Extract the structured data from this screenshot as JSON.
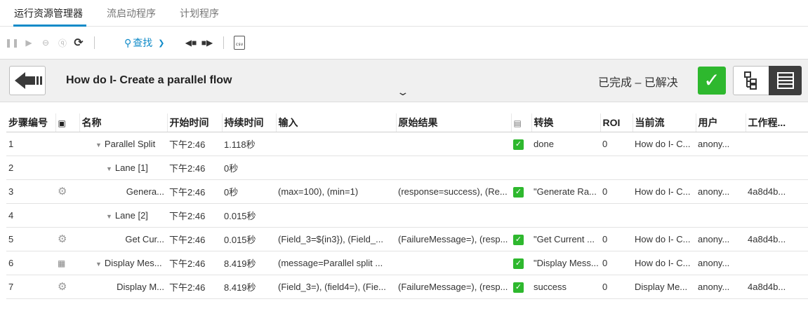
{
  "tabs": {
    "run_explorer": "运行资源管理器",
    "flow_launcher": "流启动程序",
    "scheduler": "计划程序"
  },
  "toolbar": {
    "find_label": "查找",
    "csv_label": "csv"
  },
  "header": {
    "flow_title": "How do I- Create a parallel flow",
    "status": "已完成 – 已解决"
  },
  "table": {
    "columns": {
      "step": "步骤编号",
      "name": "名称",
      "start": "开始时间",
      "duration": "持续时间",
      "input": "输入",
      "raw_result": "原始结果",
      "transition": "转换",
      "roi": "ROI",
      "current_flow": "当前流",
      "user": "用户",
      "worker": "工作程..."
    },
    "rows": [
      {
        "step": "1",
        "name": "Parallel Split",
        "start": "下午2:46",
        "duration": "1.118秒",
        "input": "",
        "raw_result": "",
        "transition": "done",
        "roi": "0",
        "current_flow": "How do I- C...",
        "user": "anony...",
        "worker": ""
      },
      {
        "step": "2",
        "name": "Lane [1]",
        "start": "下午2:46",
        "duration": "0秒",
        "input": "",
        "raw_result": "",
        "transition": "",
        "roi": "",
        "current_flow": "",
        "user": "",
        "worker": ""
      },
      {
        "step": "3",
        "name": "Genera...",
        "start": "下午2:46",
        "duration": "0秒",
        "input": "(max=100), (min=1)",
        "raw_result": "(response=success), (Re...",
        "transition": "\"Generate Ra...",
        "roi": "0",
        "current_flow": "How do I- C...",
        "user": "anony...",
        "worker": "4a8d4b..."
      },
      {
        "step": "4",
        "name": "Lane [2]",
        "start": "下午2:46",
        "duration": "0.015秒",
        "input": "",
        "raw_result": "",
        "transition": "",
        "roi": "",
        "current_flow": "",
        "user": "",
        "worker": ""
      },
      {
        "step": "5",
        "name": "Get Cur...",
        "start": "下午2:46",
        "duration": "0.015秒",
        "input": "(Field_3=${in3}), (Field_...",
        "raw_result": "(FailureMessage=), (resp...",
        "transition": "\"Get Current ...",
        "roi": "0",
        "current_flow": "How do I- C...",
        "user": "anony...",
        "worker": "4a8d4b..."
      },
      {
        "step": "6",
        "name": "Display Mes...",
        "start": "下午2:46",
        "duration": "8.419秒",
        "input": "(message=Parallel split ...",
        "raw_result": "",
        "transition": "\"Display Mess...",
        "roi": "0",
        "current_flow": "How do I- C...",
        "user": "anony...",
        "worker": ""
      },
      {
        "step": "7",
        "name": "Display M...",
        "start": "下午2:46",
        "duration": "8.419秒",
        "input": "(Field_3=), (field4=), (Fie...",
        "raw_result": "(FailureMessage=), (resp...",
        "transition": "success",
        "roi": "0",
        "current_flow": "Display Me...",
        "user": "anony...",
        "worker": "4a8d4b..."
      }
    ]
  },
  "colors": {
    "accent": "#0f8ac8",
    "success": "#2eb82e"
  }
}
